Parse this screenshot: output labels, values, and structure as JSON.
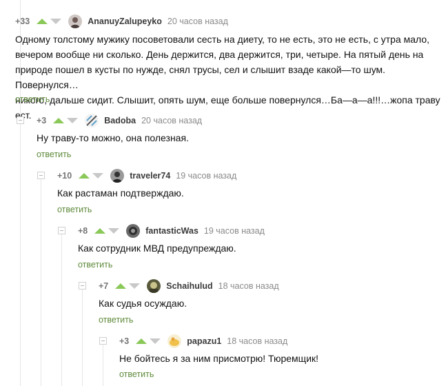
{
  "comments": [
    {
      "rating": "+33",
      "author": "AnanuyZalupeyko",
      "time": "20 часов назад",
      "avatar_icon": "avatar-icon",
      "lines": [
        "Одному толстому мужику посоветовали сесть на диету, то не есть, это не есть, с утра мало,",
        "вечером вообще ни сколько. День держится, два держится, три, четыре. На пятый день на",
        "природе пошел в кусты по нужде, снял трусы, сел и слышит взаде какой—то шум. Повернулся…",
        "никого, дальше сидит. Слышит, опять шум, еще больше повернулся…Ба—а—а!!!…жопа траву ест."
      ],
      "reply_label": "ответить"
    },
    {
      "rating": "+3",
      "author": "Badoba",
      "time": "20 часов назад",
      "avatar_icon": "avatar-icon",
      "text": "Ну траву-то можно, она полезная.",
      "reply_label": "ответить"
    },
    {
      "rating": "+10",
      "author": "traveler74",
      "time": "19 часов назад",
      "avatar_icon": "avatar-icon",
      "text": "Как растаман подтверждаю.",
      "reply_label": "ответить"
    },
    {
      "rating": "+8",
      "author": "fantasticWas",
      "time": "19 часов назад",
      "avatar_icon": "avatar-icon",
      "text": "Как сотрудник МВД предупреждаю.",
      "reply_label": "ответить"
    },
    {
      "rating": "+7",
      "author": "Schaihulud",
      "time": "18 часов назад",
      "avatar_icon": "avatar-icon",
      "text": "Как судья осуждаю.",
      "reply_label": "ответить"
    },
    {
      "rating": "+3",
      "author": "papazu1",
      "time": "18 часов назад",
      "avatar_icon": "avatar-icon",
      "text": "Не бойтесь я за ним присмотрю! Тюремщик!",
      "reply_label": "ответить"
    }
  ],
  "colors": {
    "vote_up": "#8ac858",
    "vote_down": "#c8c8c8",
    "reply_link": "#5e8a3a",
    "thread_line": "#e6e6e6"
  }
}
